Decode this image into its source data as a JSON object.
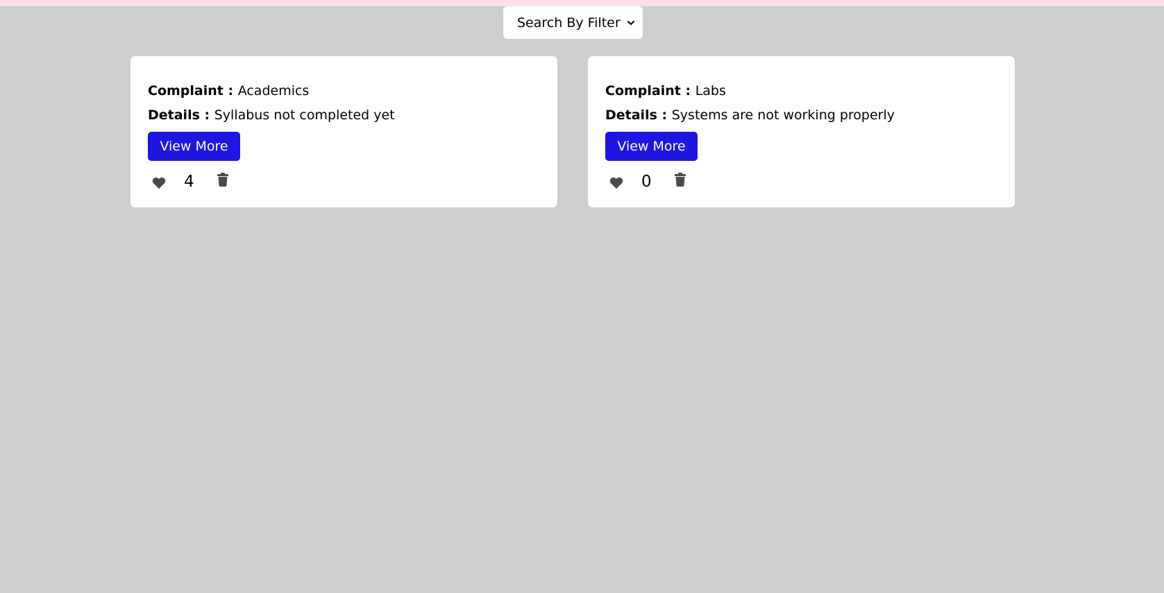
{
  "filter": {
    "label": "Search By Filter"
  },
  "complaints": [
    {
      "complaint_label": "Complaint : ",
      "complaint_value": "Academics",
      "details_label": "Details : ",
      "details_value": "Syllabus not completed yet",
      "button_label": "View More",
      "likes": "4"
    },
    {
      "complaint_label": "Complaint : ",
      "complaint_value": "Labs",
      "details_label": "Details : ",
      "details_value": "Systems are not working properly",
      "button_label": "View More",
      "likes": "0"
    }
  ],
  "icons": {
    "like": "heart-icon",
    "delete": "trash-icon",
    "dropdown": "chevron-down-icon"
  },
  "colors": {
    "background": "#cecece",
    "top_strip": "#ffe0e6",
    "card": "#ffffff",
    "button": "#1e16e0",
    "icon": "#4a4a4a"
  }
}
